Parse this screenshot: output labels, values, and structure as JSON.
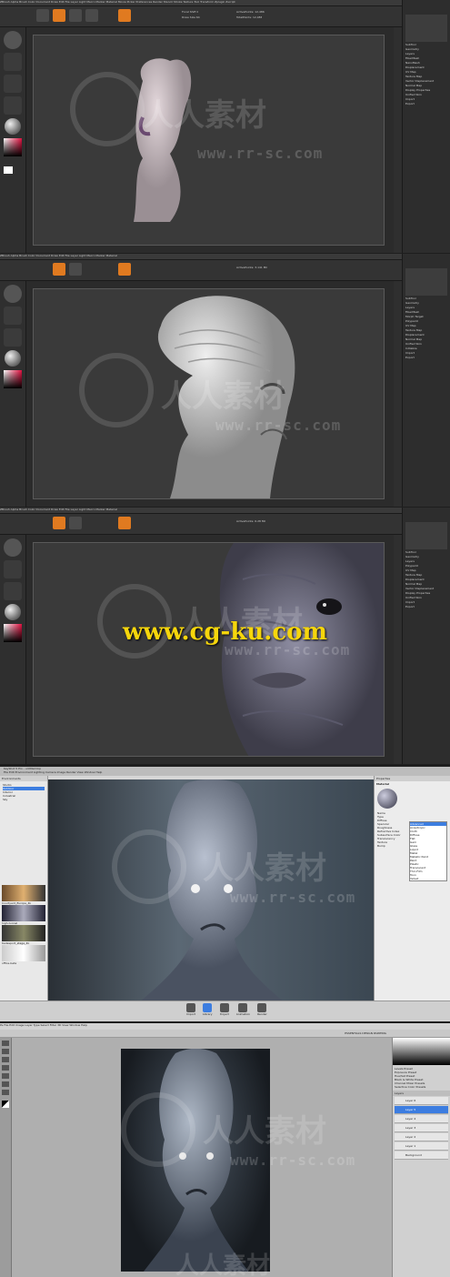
{
  "watermarks": {
    "brand_cn": "人人素材",
    "url": "www.rr-sc.com",
    "cgku": "www.cg-ku.com"
  },
  "zbrush_1": {
    "menubar": "ZBrush  Alpha  Brush  Color  Document  Draw  Edit  File  Layer  Light  Macro  Marker  Material  Movie  Picker  Preferences  Render  Stencil  Stroke  Texture  Tool  Transform  Zplugin  Zscript",
    "tool_menu": [
      "SubTool",
      "Geometry",
      "Layers",
      "FiberMesh",
      "NanoMesh",
      "Displacement",
      "UV Map",
      "Texture Map",
      "Vector Displacement",
      "Normal Map",
      "Display Properties",
      "Unified Skin",
      "Import",
      "Export"
    ],
    "focal": "Focal Shift 0",
    "rgb": "Rgb Intensity 100",
    "draw": "Draw Size 64",
    "points": "ActivePoints: 12,486",
    "total": "TotalPoints: 12,486"
  },
  "zbrush_2": {
    "menubar": "ZBrush  Alpha  Brush  Color  Document  Draw  Edit  File  Layer  Light  Macro  Marker  Material",
    "tool_menu": [
      "SubTool",
      "Geometry",
      "Layers",
      "FiberMesh",
      "Morph Target",
      "Polypaint",
      "UV Map",
      "Texture Map",
      "Displacement",
      "Normal Map",
      "Unified Skin",
      "Initialize",
      "Import",
      "Export"
    ],
    "points": "ActivePoints: 3.141 Mil"
  },
  "zbrush_3": {
    "menubar": "ZBrush  Alpha  Brush  Color  Document  Draw  Edit  File  Layer  Light  Macro  Marker  Material",
    "tool_menu": [
      "SubTool",
      "Geometry",
      "Layers",
      "Polypaint",
      "UV Map",
      "Texture Map",
      "Displacement",
      "Normal Map",
      "Vector Displacement",
      "Display Properties",
      "Unified Skin",
      "Import",
      "Export"
    ],
    "points": "ActivePoints: 6.28 Mil"
  },
  "keyshot": {
    "title": "KeyShot 5 Pro - untitled.bip",
    "menubar": "File  Edit  Environment  Lighting  Camera  Image  Render  View  Window  Help",
    "library_tab": "Environments",
    "library_items": [
      "Studio",
      "Outdoor",
      "Interior",
      "Industrial",
      "Sky"
    ],
    "env_thumbs": [
      "Courtyard_Europe_4k",
      "high-tunnel",
      "Kadesport_stage_4k",
      "office-beta"
    ],
    "props_title": "Properties",
    "props_tab": "Material",
    "props_fields": [
      "Name",
      "Type",
      "Diffuse",
      "Specular",
      "Roughness",
      "Refractive Index",
      "Subsurface Color",
      "Translucency",
      "Texture",
      "Bump"
    ],
    "dropdown_options": [
      "Advanced",
      "Anisotropic",
      "Cloth",
      "Diffuse",
      "Flat",
      "Gem",
      "Glass",
      "Liquid",
      "Metal",
      "Metallic Paint",
      "Paint",
      "Plastic",
      "Translucent",
      "Thin Film",
      "Toon",
      "Velvet"
    ],
    "bottom_buttons": [
      "Import",
      "Library",
      "Project",
      "Animation",
      "Render"
    ]
  },
  "photoshop": {
    "menubar": "Ps  File  Edit  Image  Layer  Type  Select  Filter  3D  View  Window  Help",
    "workspace": "ESSENTIALS  DESIGN  PAINTING",
    "panels_title": "Layers",
    "layers": [
      "Layer 6",
      "Layer 5",
      "Layer 4",
      "Layer 3",
      "Layer 2",
      "Layer 1",
      "Background"
    ],
    "adjustments": [
      "Levels Preset",
      "Exposure Preset",
      "Hue/Sat Preset",
      "Black & White Preset",
      "Channel Mixer Presets",
      "Selective Color Presets"
    ]
  }
}
